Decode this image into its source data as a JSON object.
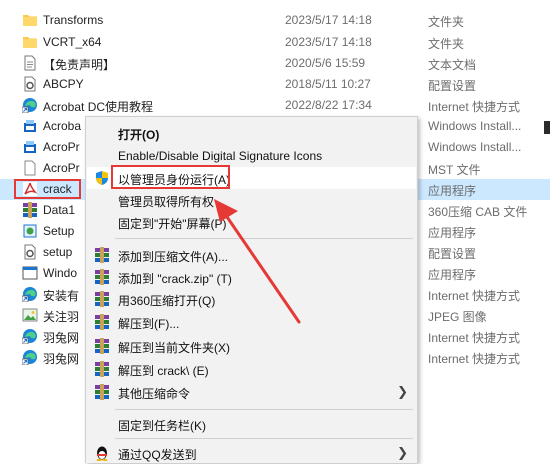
{
  "files": [
    {
      "name": "Transforms",
      "date": "2023/5/17 14:18",
      "type": "文件夹",
      "icon": "folder-icon"
    },
    {
      "name": "VCRT_x64",
      "date": "2023/5/17 14:18",
      "type": "文件夹",
      "icon": "folder-icon"
    },
    {
      "name": "【免责声明】",
      "date": "2020/5/6 15:59",
      "type": "文本文档",
      "icon": "text-file-icon"
    },
    {
      "name": "ABCPY",
      "date": "2018/5/11 10:27",
      "type": "配置设置",
      "icon": "settings-file-icon"
    },
    {
      "name": "Acrobat DC使用教程",
      "date": "2022/8/22 17:34",
      "type": "Internet 快捷方式",
      "icon": "edge-shortcut-icon"
    },
    {
      "name": "Acroba",
      "date": "",
      "type": "Windows Install...",
      "icon": "installer-icon"
    },
    {
      "name": "AcroPr",
      "date": "",
      "type": "Windows Install...",
      "icon": "installer-icon"
    },
    {
      "name": "AcroPr",
      "date": "",
      "type": "MST 文件",
      "icon": "blank-file-icon"
    },
    {
      "name": "crack",
      "date": "",
      "type": "应用程序",
      "icon": "acrobat-app-icon"
    },
    {
      "name": "Data1",
      "date": "",
      "type": "360压缩 CAB 文件",
      "icon": "archive-icon"
    },
    {
      "name": "Setup",
      "date": "",
      "type": "应用程序",
      "icon": "setup-icon"
    },
    {
      "name": "setup",
      "date": "",
      "type": "配置设置",
      "icon": "settings-file-icon"
    },
    {
      "name": "Windo",
      "date": "",
      "type": "应用程序",
      "icon": "windows-app-icon"
    },
    {
      "name": "安装有",
      "date": "",
      "type": "Internet 快捷方式",
      "icon": "edge-shortcut-icon"
    },
    {
      "name": "关注羽",
      "date": "",
      "type": "JPEG 图像",
      "icon": "image-icon"
    },
    {
      "name": "羽兔网",
      "date": "",
      "type": "Internet 快捷方式",
      "icon": "edge-shortcut-icon"
    },
    {
      "name": "羽兔网",
      "date": "",
      "type": "Internet 快捷方式",
      "icon": "edge-shortcut-icon"
    }
  ],
  "menu": {
    "open": "打开(O)",
    "signature": "Enable/Disable Digital Signature Icons",
    "run_as_admin": "以管理员身份运行(A)",
    "take_ownership": "管理员取得所有权",
    "pin_start": "固定到\"开始\"屏幕(P)",
    "add_archive": "添加到压缩文件(A)...",
    "add_zip": "添加到 \"crack.zip\" (T)",
    "open_360": "用360压缩打开(Q)",
    "extract_to": "解压到(F)...",
    "extract_here": "解压到当前文件夹(X)",
    "extract_crack": "解压到 crack\\ (E)",
    "other_compress": "其他压缩命令",
    "pin_taskbar": "固定到任务栏(K)",
    "send_qq": "通过QQ发送到"
  },
  "colors": {
    "selection": "#cce8ff",
    "highlight_red": "#e53935",
    "menu_bg": "#f2f2f2"
  }
}
